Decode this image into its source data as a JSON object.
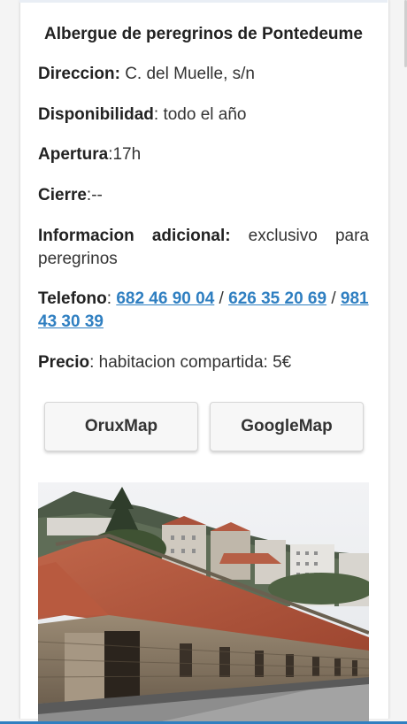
{
  "title": "Albergue de peregrinos de Pontedeume",
  "direccion": {
    "label": "Direccion:",
    "value": " C. del Muelle, s/n"
  },
  "disponibilidad": {
    "label": "Disponibilidad",
    "value": ": todo el año"
  },
  "apertura": {
    "label": "Apertura",
    "value": ":17h"
  },
  "cierre": {
    "label": "Cierre",
    "value": ":--"
  },
  "informacion": {
    "label": "Informacion adicional:",
    "value": " exclusivo para peregrinos"
  },
  "telefono": {
    "label": "Telefono",
    "sep1": ": ",
    "phones": [
      "682 46 90 04",
      "626 35 20 69",
      "981 43 30 39"
    ],
    "sep": " / "
  },
  "precio": {
    "label": "Precio",
    "value": ": habitacion compartida: 5€"
  },
  "buttons": {
    "oruxmap": "OruxMap",
    "googlemap": "GoogleMap"
  },
  "colors": {
    "link": "#2f7fc1",
    "roof": "#b5543c",
    "stone": "#8a7a66"
  }
}
